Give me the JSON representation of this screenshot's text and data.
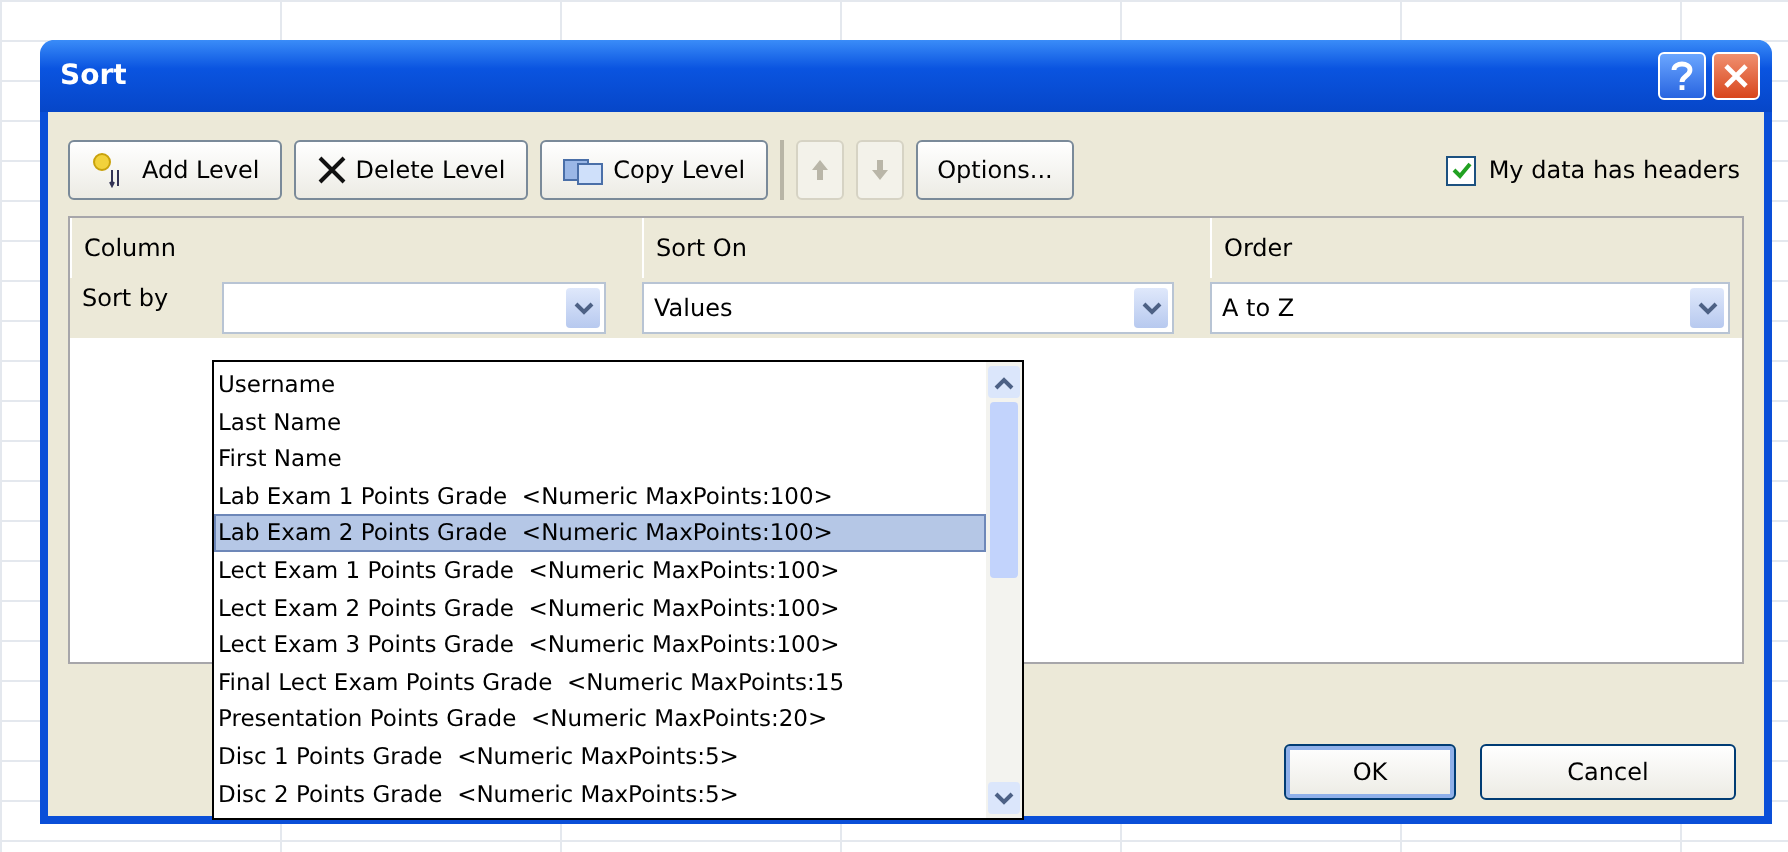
{
  "window": {
    "title": "Sort"
  },
  "toolbar": [
    {
      "kind": "add",
      "label": "Add Level",
      "disabled": false
    },
    {
      "kind": "delete",
      "label": "Delete Level",
      "disabled": false
    },
    {
      "kind": "copy",
      "label": "Copy Level",
      "disabled": false
    },
    {
      "kind": "up",
      "disabled": true
    },
    {
      "kind": "down",
      "disabled": true
    },
    {
      "kind": "text",
      "label": "Options...",
      "disabled": false
    }
  ],
  "headers_checkbox": {
    "label": "My data has headers",
    "checked": true
  },
  "columns": [
    "Column",
    "Sort On",
    "Order"
  ],
  "level": {
    "label": "Sort by",
    "sort_on": "Values",
    "order": "A to Z"
  },
  "dropdown": [
    {
      "label": "Username",
      "selected": false
    },
    {
      "label": "Last Name",
      "selected": false
    },
    {
      "label": "First Name",
      "selected": false
    },
    {
      "label": "Lab Exam 1 Points Grade  <Numeric MaxPoints:100>",
      "selected": false
    },
    {
      "label": "Lab Exam 2 Points Grade  <Numeric MaxPoints:100>",
      "selected": true
    },
    {
      "label": "Lect Exam 1 Points Grade  <Numeric MaxPoints:100>",
      "selected": false
    },
    {
      "label": "Lect Exam 2 Points Grade  <Numeric MaxPoints:100>",
      "selected": false
    },
    {
      "label": "Lect Exam 3 Points Grade  <Numeric MaxPoints:100>",
      "selected": false
    },
    {
      "label": "Final Lect Exam Points Grade  <Numeric MaxPoints:15",
      "selected": false
    },
    {
      "label": "Presentation Points Grade  <Numeric MaxPoints:20>",
      "selected": false
    },
    {
      "label": "Disc 1 Points Grade  <Numeric MaxPoints:5>",
      "selected": false
    },
    {
      "label": "Disc 2 Points Grade  <Numeric MaxPoints:5>",
      "selected": false
    }
  ],
  "buttons": [
    "OK",
    "Cancel"
  ]
}
